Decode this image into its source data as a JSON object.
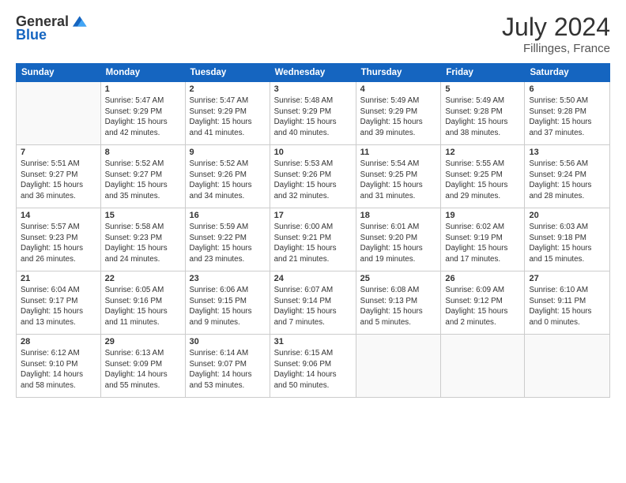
{
  "header": {
    "logo_general": "General",
    "logo_blue": "Blue",
    "month_year": "July 2024",
    "location": "Fillinges, France"
  },
  "days_of_week": [
    "Sunday",
    "Monday",
    "Tuesday",
    "Wednesday",
    "Thursday",
    "Friday",
    "Saturday"
  ],
  "weeks": [
    [
      {
        "day": "",
        "info": ""
      },
      {
        "day": "1",
        "info": "Sunrise: 5:47 AM\nSunset: 9:29 PM\nDaylight: 15 hours\nand 42 minutes."
      },
      {
        "day": "2",
        "info": "Sunrise: 5:47 AM\nSunset: 9:29 PM\nDaylight: 15 hours\nand 41 minutes."
      },
      {
        "day": "3",
        "info": "Sunrise: 5:48 AM\nSunset: 9:29 PM\nDaylight: 15 hours\nand 40 minutes."
      },
      {
        "day": "4",
        "info": "Sunrise: 5:49 AM\nSunset: 9:29 PM\nDaylight: 15 hours\nand 39 minutes."
      },
      {
        "day": "5",
        "info": "Sunrise: 5:49 AM\nSunset: 9:28 PM\nDaylight: 15 hours\nand 38 minutes."
      },
      {
        "day": "6",
        "info": "Sunrise: 5:50 AM\nSunset: 9:28 PM\nDaylight: 15 hours\nand 37 minutes."
      }
    ],
    [
      {
        "day": "7",
        "info": "Sunrise: 5:51 AM\nSunset: 9:27 PM\nDaylight: 15 hours\nand 36 minutes."
      },
      {
        "day": "8",
        "info": "Sunrise: 5:52 AM\nSunset: 9:27 PM\nDaylight: 15 hours\nand 35 minutes."
      },
      {
        "day": "9",
        "info": "Sunrise: 5:52 AM\nSunset: 9:26 PM\nDaylight: 15 hours\nand 34 minutes."
      },
      {
        "day": "10",
        "info": "Sunrise: 5:53 AM\nSunset: 9:26 PM\nDaylight: 15 hours\nand 32 minutes."
      },
      {
        "day": "11",
        "info": "Sunrise: 5:54 AM\nSunset: 9:25 PM\nDaylight: 15 hours\nand 31 minutes."
      },
      {
        "day": "12",
        "info": "Sunrise: 5:55 AM\nSunset: 9:25 PM\nDaylight: 15 hours\nand 29 minutes."
      },
      {
        "day": "13",
        "info": "Sunrise: 5:56 AM\nSunset: 9:24 PM\nDaylight: 15 hours\nand 28 minutes."
      }
    ],
    [
      {
        "day": "14",
        "info": "Sunrise: 5:57 AM\nSunset: 9:23 PM\nDaylight: 15 hours\nand 26 minutes."
      },
      {
        "day": "15",
        "info": "Sunrise: 5:58 AM\nSunset: 9:23 PM\nDaylight: 15 hours\nand 24 minutes."
      },
      {
        "day": "16",
        "info": "Sunrise: 5:59 AM\nSunset: 9:22 PM\nDaylight: 15 hours\nand 23 minutes."
      },
      {
        "day": "17",
        "info": "Sunrise: 6:00 AM\nSunset: 9:21 PM\nDaylight: 15 hours\nand 21 minutes."
      },
      {
        "day": "18",
        "info": "Sunrise: 6:01 AM\nSunset: 9:20 PM\nDaylight: 15 hours\nand 19 minutes."
      },
      {
        "day": "19",
        "info": "Sunrise: 6:02 AM\nSunset: 9:19 PM\nDaylight: 15 hours\nand 17 minutes."
      },
      {
        "day": "20",
        "info": "Sunrise: 6:03 AM\nSunset: 9:18 PM\nDaylight: 15 hours\nand 15 minutes."
      }
    ],
    [
      {
        "day": "21",
        "info": "Sunrise: 6:04 AM\nSunset: 9:17 PM\nDaylight: 15 hours\nand 13 minutes."
      },
      {
        "day": "22",
        "info": "Sunrise: 6:05 AM\nSunset: 9:16 PM\nDaylight: 15 hours\nand 11 minutes."
      },
      {
        "day": "23",
        "info": "Sunrise: 6:06 AM\nSunset: 9:15 PM\nDaylight: 15 hours\nand 9 minutes."
      },
      {
        "day": "24",
        "info": "Sunrise: 6:07 AM\nSunset: 9:14 PM\nDaylight: 15 hours\nand 7 minutes."
      },
      {
        "day": "25",
        "info": "Sunrise: 6:08 AM\nSunset: 9:13 PM\nDaylight: 15 hours\nand 5 minutes."
      },
      {
        "day": "26",
        "info": "Sunrise: 6:09 AM\nSunset: 9:12 PM\nDaylight: 15 hours\nand 2 minutes."
      },
      {
        "day": "27",
        "info": "Sunrise: 6:10 AM\nSunset: 9:11 PM\nDaylight: 15 hours\nand 0 minutes."
      }
    ],
    [
      {
        "day": "28",
        "info": "Sunrise: 6:12 AM\nSunset: 9:10 PM\nDaylight: 14 hours\nand 58 minutes."
      },
      {
        "day": "29",
        "info": "Sunrise: 6:13 AM\nSunset: 9:09 PM\nDaylight: 14 hours\nand 55 minutes."
      },
      {
        "day": "30",
        "info": "Sunrise: 6:14 AM\nSunset: 9:07 PM\nDaylight: 14 hours\nand 53 minutes."
      },
      {
        "day": "31",
        "info": "Sunrise: 6:15 AM\nSunset: 9:06 PM\nDaylight: 14 hours\nand 50 minutes."
      },
      {
        "day": "",
        "info": ""
      },
      {
        "day": "",
        "info": ""
      },
      {
        "day": "",
        "info": ""
      }
    ]
  ]
}
